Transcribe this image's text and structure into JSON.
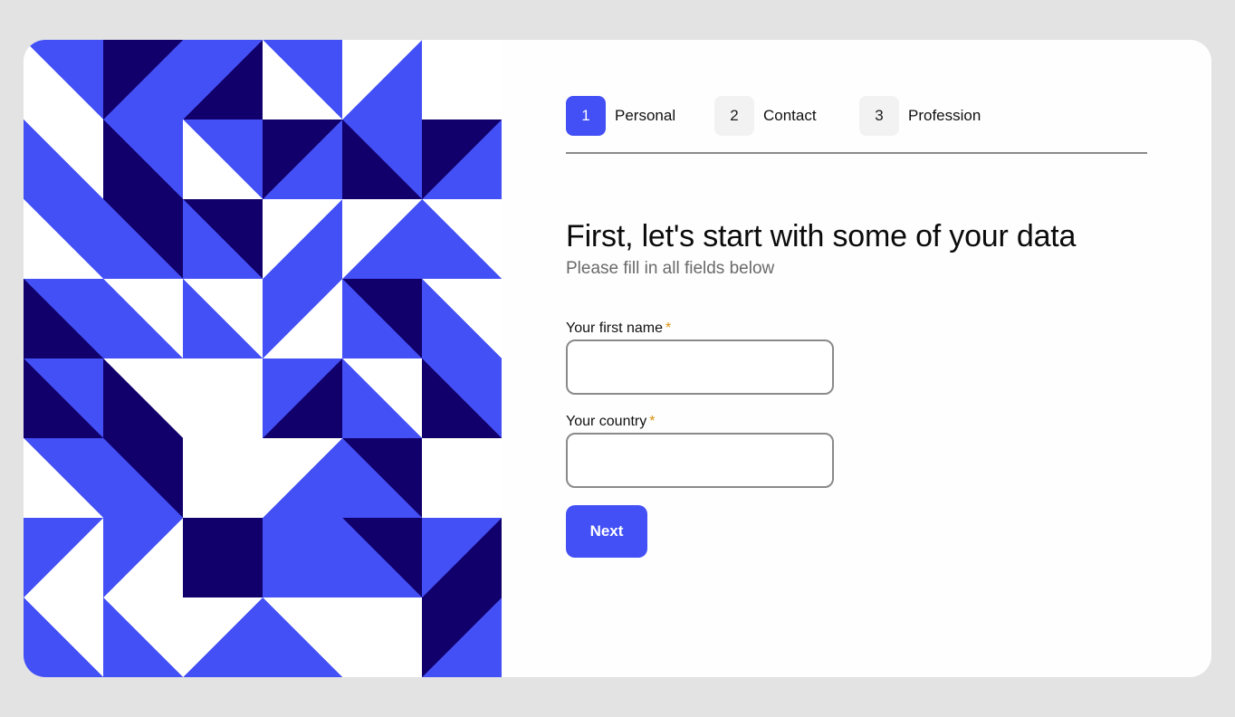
{
  "steps": [
    {
      "number": "1",
      "label": "Personal",
      "active": true
    },
    {
      "number": "2",
      "label": "Contact",
      "active": false
    },
    {
      "number": "3",
      "label": "Profession",
      "active": false
    }
  ],
  "heading": {
    "title": "First, let's start with some of your data",
    "subtitle": "Please fill in all fields below"
  },
  "form": {
    "first_name": {
      "label": "Your first name",
      "required_marker": "*",
      "value": "",
      "placeholder": ""
    },
    "country": {
      "label": "Your country",
      "required_marker": "*",
      "value": "",
      "placeholder": ""
    },
    "next_label": "Next"
  },
  "colors": {
    "accent": "#4350f5",
    "dark": "#11006b",
    "light": "#ffffff",
    "background": "#e3e3e3",
    "required": "#d9900a"
  }
}
